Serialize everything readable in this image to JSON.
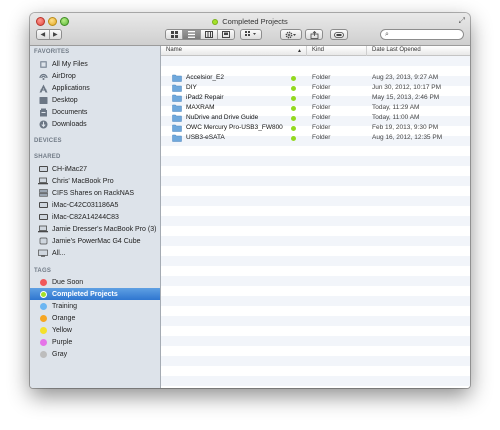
{
  "window": {
    "title": "Completed Projects",
    "title_tag_color": "#a4e12a"
  },
  "toolbar": {
    "back": "◀",
    "forward": "▶",
    "view_buttons": [
      "icon-view",
      "list-view",
      "column-view",
      "coverflow-view"
    ],
    "arrange": "arrange-icon",
    "action": "gear-icon",
    "share": "share-icon",
    "tags": "tag-icon",
    "search_placeholder": ""
  },
  "sidebar": {
    "favorites_heading": "FAVORITES",
    "favorites": [
      {
        "label": "All My Files",
        "icon": "all-files-icon"
      },
      {
        "label": "AirDrop",
        "icon": "airdrop-icon"
      },
      {
        "label": "Applications",
        "icon": "applications-icon"
      },
      {
        "label": "Desktop",
        "icon": "desktop-icon"
      },
      {
        "label": "Documents",
        "icon": "documents-icon"
      },
      {
        "label": "Downloads",
        "icon": "downloads-icon"
      }
    ],
    "devices_heading": "DEVICES",
    "shared_heading": "SHARED",
    "shared": [
      {
        "label": "CH-iMac27"
      },
      {
        "label": "Chris' MacBook Pro"
      },
      {
        "label": "CIFS Shares on RackNAS"
      },
      {
        "label": "iMac-C42C031186A5"
      },
      {
        "label": "iMac-C82A14244C83"
      },
      {
        "label": "Jamie Dresser's MacBook Pro (3)"
      },
      {
        "label": "Jamie's PowerMac G4 Cube"
      },
      {
        "label": "All..."
      }
    ],
    "tags_heading": "TAGS",
    "tags": [
      {
        "label": "Due Soon",
        "color": "#f0575a"
      },
      {
        "label": "Completed Projects",
        "color": "#a4e12a",
        "selected": true
      },
      {
        "label": "Training",
        "color": "#6cb6f2"
      },
      {
        "label": "Orange",
        "color": "#f6a623"
      },
      {
        "label": "Yellow",
        "color": "#f4e12b"
      },
      {
        "label": "Purple",
        "color": "#e574e8"
      },
      {
        "label": "Gray",
        "color": "#bdbdbd"
      }
    ]
  },
  "columns": {
    "name": "Name",
    "kind": "Kind",
    "date": "Date Last Opened",
    "sort_indicator": "▲"
  },
  "files": [
    {
      "name": "Accelsior_E2",
      "kind": "Folder",
      "date": "Aug 23, 2013, 9:27 AM"
    },
    {
      "name": "DIY",
      "kind": "Folder",
      "date": "Jun 30, 2012, 10:17 PM"
    },
    {
      "name": "iPad2 Repair",
      "kind": "Folder",
      "date": "May 15, 2013, 2:46 PM"
    },
    {
      "name": "MAXRAM",
      "kind": "Folder",
      "date": "Today, 11:29 AM"
    },
    {
      "name": "NuDrive and Drive Guide",
      "kind": "Folder",
      "date": "Today, 11:00 AM"
    },
    {
      "name": "OWC Mercury Pro-USB3_FW800",
      "kind": "Folder",
      "date": "Feb 19, 2013, 9:30 PM"
    },
    {
      "name": "USB3-eSATA",
      "kind": "Folder",
      "date": "Aug 16, 2012, 12:35 PM"
    }
  ]
}
